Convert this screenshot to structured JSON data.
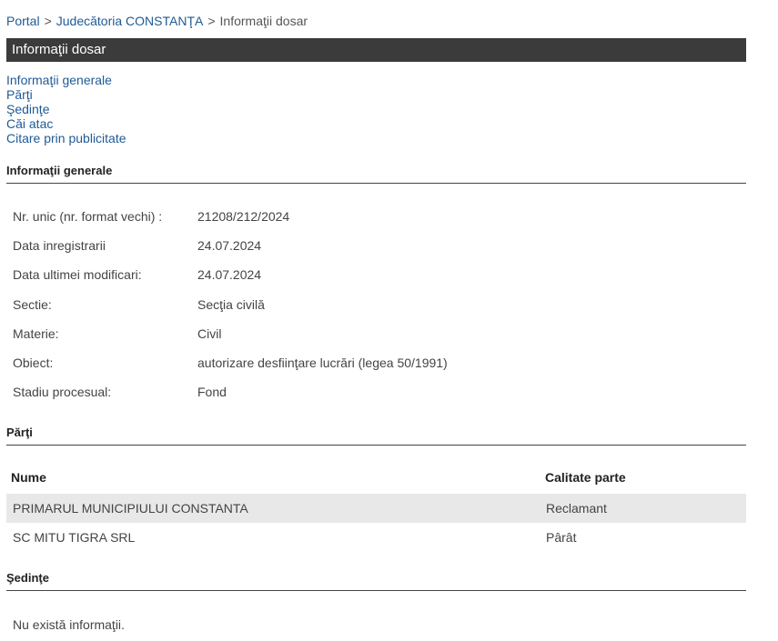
{
  "breadcrumb": {
    "portal": "Portal",
    "court": "Judecătoria CONSTANŢA",
    "current": "Informaţii dosar",
    "separator": ">"
  },
  "title": "Informaţii dosar",
  "anchors": {
    "general": "Informaţii generale",
    "parties": "Părţi",
    "sessions": "Şedinţe",
    "appeals": "Căi atac",
    "summons": "Citare prin publicitate"
  },
  "sections": {
    "general": "Informaţii generale",
    "parties": "Părţi",
    "sessions": "Şedinţe"
  },
  "info": [
    {
      "label": "Nr. unic (nr. format vechi) :",
      "value": "21208/212/2024"
    },
    {
      "label": "Data inregistrarii",
      "value": "24.07.2024"
    },
    {
      "label": "Data ultimei modificari:",
      "value": "24.07.2024"
    },
    {
      "label": "Sectie:",
      "value": "Secţia civilă"
    },
    {
      "label": "Materie:",
      "value": "Civil"
    },
    {
      "label": "Obiect:",
      "value": "autorizare desfiinţare lucrări (legea 50/1991)"
    },
    {
      "label": "Stadiu procesual:",
      "value": "Fond"
    }
  ],
  "parties": {
    "headers": {
      "name": "Nume",
      "role": "Calitate parte"
    },
    "rows": [
      {
        "name": "PRIMARUL MUNICIPIULUI CONSTANTA",
        "role": "Reclamant"
      },
      {
        "name": "SC MITU TIGRA SRL",
        "role": "Pârât"
      }
    ]
  },
  "sessions_empty": "Nu există informaţii.",
  "colors": {
    "link": "#1f5a96",
    "title_bar": "#3b3b3b",
    "row_shade": "#e8e8e8"
  }
}
